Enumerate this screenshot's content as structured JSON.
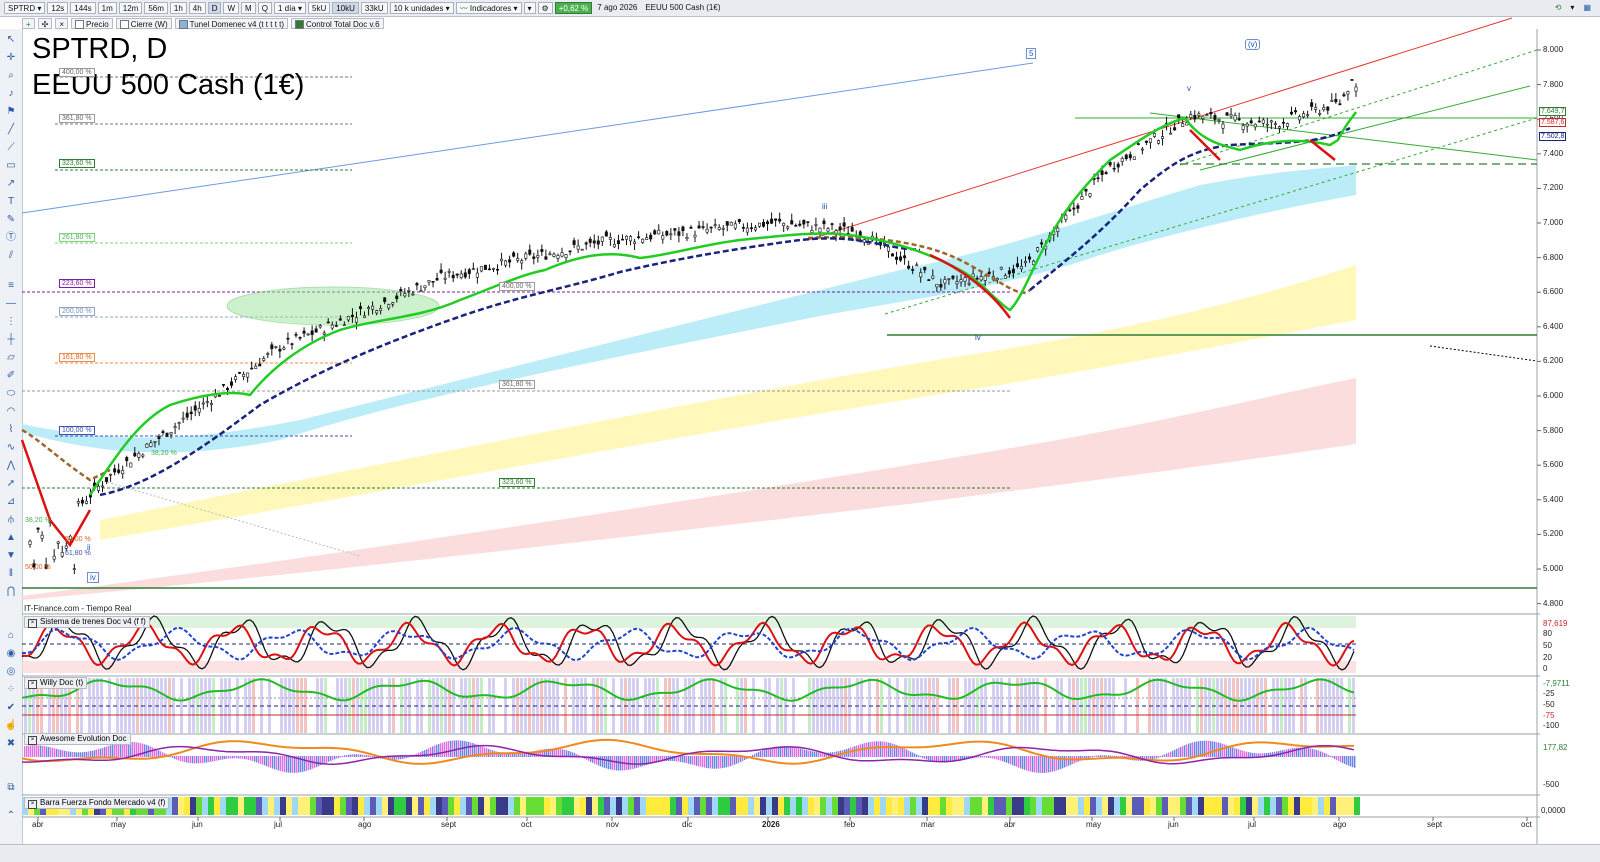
{
  "toolbar": {
    "symbol": "SPTRD",
    "timeframes": [
      "12s",
      "144s",
      "1m",
      "12m",
      "56m",
      "1h",
      "4h",
      "D",
      "W",
      "M",
      "Q"
    ],
    "period": "1 día",
    "volumes": [
      "5kU",
      "10kU",
      "33kU"
    ],
    "units": "10 k unidades",
    "indicators": "Indicadores",
    "change": "+0,62 %",
    "date": "7 ago 2026",
    "instrument": "EEUU 500 Cash (1€)"
  },
  "legend_row": [
    "Precio",
    "Cierre (W)",
    "Tunel Domenec v4 (t t t t t)",
    "Control Total Doc v.6"
  ],
  "title": {
    "line1": "SPTRD, D",
    "line2": "EEUU 500 Cash (1€)"
  },
  "price_axis": [
    "8.000",
    "7.800",
    "7.600",
    "7.400",
    "7.200",
    "7.000",
    "6.800",
    "6.600",
    "6.400",
    "6.200",
    "6.000",
    "5.800",
    "5.600",
    "5.400",
    "5.200",
    "5.000",
    "4.800"
  ],
  "price_boxes": [
    "7.649,7",
    "7.587,6",
    "7.502,8"
  ],
  "fib_labels": {
    "left": [
      "400,00 %",
      "361,80 %",
      "323,60 %",
      "261,80 %",
      "223,60 %",
      "200,00 %",
      "161,80 %",
      "100,00 %",
      "38,20 %",
      "50,00 %",
      "61,80 %",
      "38,20 %",
      "50,00 %"
    ],
    "mid": [
      "400,00 %",
      "361,80 %",
      "323,60 %"
    ]
  },
  "wave_labels": {
    "box5": "5",
    "boxv": "(v)",
    "iii": "iii",
    "iv": "iv",
    "v": "v",
    "ii": "ii",
    "iv_box": "iv"
  },
  "source": "IT-Finance.com - Tiempo Real",
  "panels": [
    {
      "title": "Sistema de trenes Doc v4 (f f)",
      "axis": [
        "80",
        "50",
        "20",
        "0"
      ],
      "value": "87,619"
    },
    {
      "title": "Willy Doc (t)",
      "axis": [
        "-25",
        "-50",
        "-75",
        "-100"
      ],
      "value": "-7,9711"
    },
    {
      "title": "Awesome Evolution Doc",
      "axis": [
        "-500"
      ],
      "value": "177,82"
    },
    {
      "title": "Barra Fuerza Fondo Mercado v4 (f)",
      "axis": [],
      "value": "0,0000"
    }
  ],
  "months": [
    "abr",
    "may",
    "jun",
    "jul",
    "ago",
    "sept",
    "oct",
    "nov",
    "dic",
    "2026",
    "feb",
    "mar",
    "abr",
    "may",
    "jun",
    "jul",
    "ago",
    "sept",
    "oct"
  ],
  "chart_data": {
    "type": "candlestick",
    "x_months": [
      "abr",
      "may",
      "jun",
      "jul",
      "ago",
      "sept",
      "oct",
      "nov",
      "dic",
      "2026",
      "feb",
      "mar",
      "abr",
      "may",
      "jun",
      "jul",
      "ago"
    ],
    "close_approx": [
      5100,
      5550,
      5900,
      6250,
      6450,
      6650,
      6750,
      6850,
      6900,
      6950,
      6900,
      6600,
      6700,
      7250,
      7550,
      7500,
      7650
    ],
    "last_high": 7780,
    "ylim": [
      4800,
      8100
    ]
  },
  "colors": {
    "up_ema": "#22cc22",
    "down_ema": "#dd1111",
    "slow_ma": "#1a237e",
    "cyan_band": "#aeeaf7",
    "yellow_band": "#fff7b3",
    "pink_band": "#fbd5d5"
  }
}
